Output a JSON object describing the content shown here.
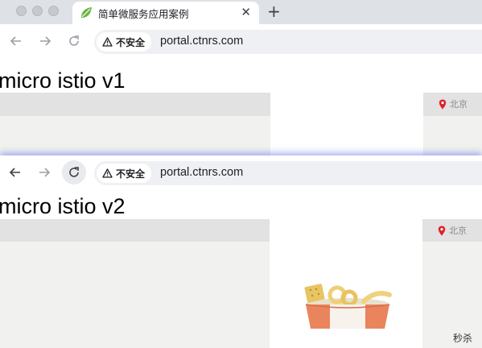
{
  "window1": {
    "tab": {
      "title": "简单微服务应用案例",
      "favicon": "leaf-icon"
    },
    "toolbar": {
      "security_label": "不安全",
      "url": "portal.ctnrs.com"
    },
    "page": {
      "heading": "micro istio v1",
      "location": "北京"
    }
  },
  "window2": {
    "toolbar": {
      "security_label": "不安全",
      "url": "portal.ctnrs.com"
    },
    "page": {
      "heading": "micro istio v2",
      "location": "北京",
      "seckill_label": "秒杀"
    }
  },
  "colors": {
    "tabstrip": "#dee1e6",
    "omnibox": "#eef0f4",
    "location_pin": "#e0202a",
    "favicon_leaf": "#6db33f"
  }
}
